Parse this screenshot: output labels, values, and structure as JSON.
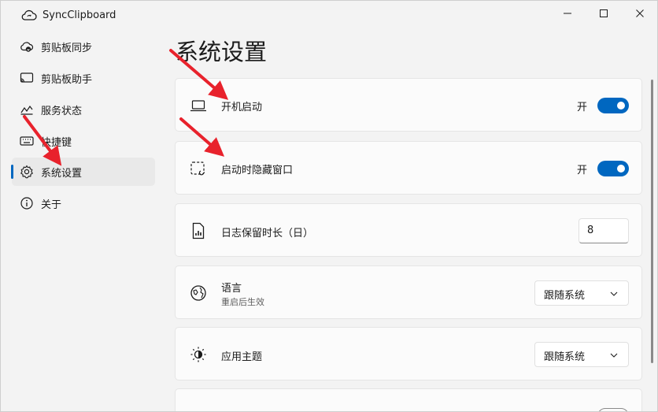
{
  "window": {
    "title": "SyncClipboard"
  },
  "sidebar": {
    "items": [
      {
        "label": "剪贴板同步",
        "icon": "cloud-sync-icon",
        "active": false
      },
      {
        "label": "剪贴板助手",
        "icon": "cast-icon",
        "active": false
      },
      {
        "label": "服务状态",
        "icon": "status-chart-icon",
        "active": false
      },
      {
        "label": "快捷键",
        "icon": "keyboard-icon",
        "active": false
      },
      {
        "label": "系统设置",
        "icon": "gear-icon",
        "active": true
      },
      {
        "label": "关于",
        "icon": "info-icon",
        "active": false
      }
    ]
  },
  "page": {
    "title": "系统设置"
  },
  "settings": {
    "startup": {
      "label": "开机启动",
      "icon": "laptop-icon",
      "state_text": "开",
      "on": true
    },
    "hide_window": {
      "label": "启动时隐藏窗口",
      "icon": "hidden-window-icon",
      "state_text": "开",
      "on": true
    },
    "log_days": {
      "label": "日志保留时长（日）",
      "icon": "log-file-icon",
      "value": "8"
    },
    "language": {
      "label": "语言",
      "sublabel": "重启后生效",
      "icon": "globe-icon",
      "selected": "跟随系统"
    },
    "theme": {
      "label": "应用主题",
      "icon": "brightness-icon",
      "selected": "跟随系统"
    }
  },
  "colors": {
    "accent": "#0067c0",
    "annotation_arrow": "#e8222c"
  }
}
